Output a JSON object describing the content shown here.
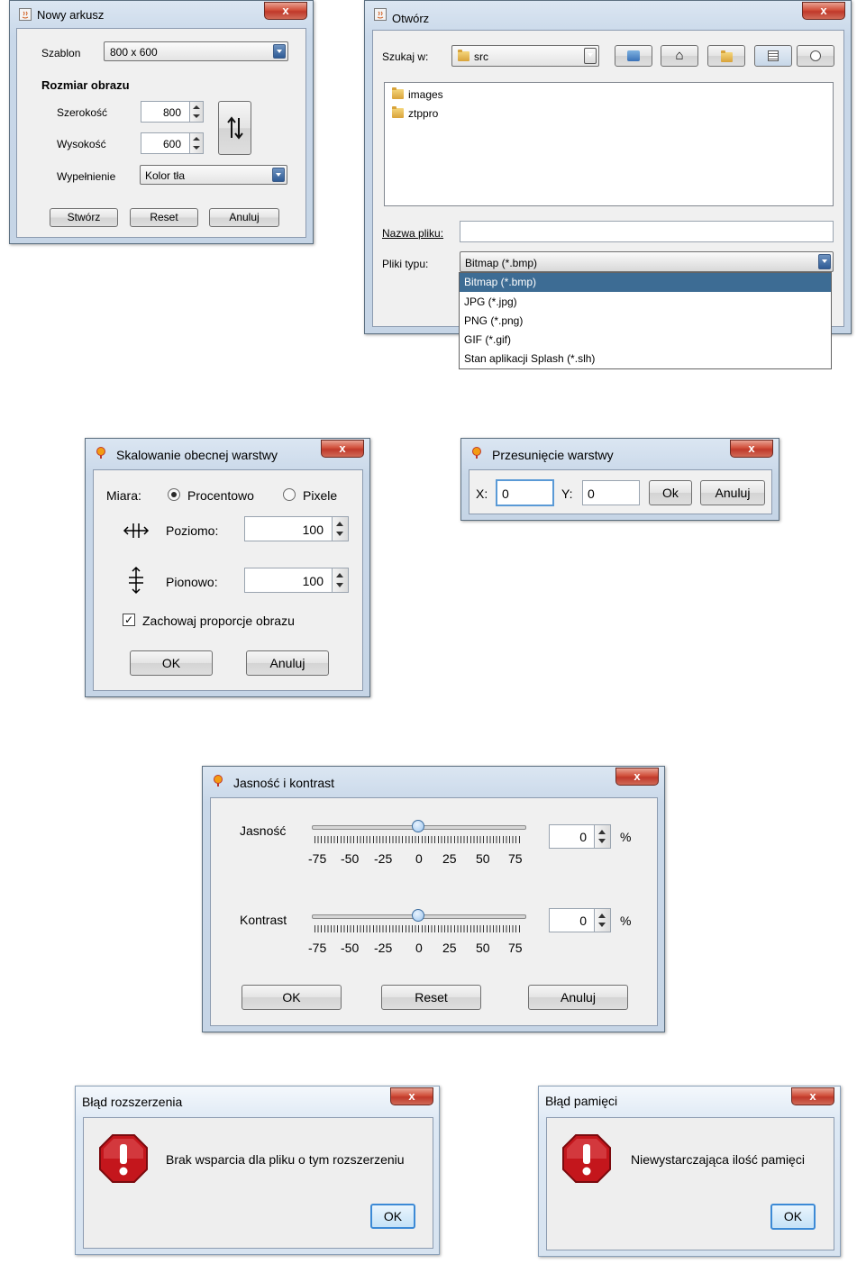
{
  "nowy_arkusz": {
    "title": "Nowy arkusz",
    "close": "x",
    "szablon_label": "Szablon",
    "szablon_value": "800 x 600",
    "section": "Rozmiar obrazu",
    "szerokosc_label": "Szerokość",
    "szerokosc_value": "800",
    "wysokosc_label": "Wysokość",
    "wysokosc_value": "600",
    "swap_icon": "swap-arrows",
    "wypelnienie_label": "Wypełnienie",
    "wypelnienie_value": "Kolor tła",
    "btn_create": "Stwórz",
    "btn_reset": "Reset",
    "btn_cancel": "Anuluj"
  },
  "otworz": {
    "title": "Otwórz",
    "close": "x",
    "lookin_label": "Szukaj w:",
    "lookin_value": "src",
    "files": [
      "images",
      "ztppro"
    ],
    "filename_label": "Nazwa pliku:",
    "filename_value": "",
    "filetype_label": "Pliki typu:",
    "filetype_value": "Bitmap (*.bmp)",
    "options": [
      "Bitmap (*.bmp)",
      "JPG (*.jpg)",
      "PNG (*.png)",
      "GIF (*.gif)",
      "Stan aplikacji Splash (*.slh)"
    ]
  },
  "skalowanie": {
    "title": "Skalowanie obecnej warstwy",
    "close": "x",
    "miara_label": "Miara:",
    "opt_percent": "Procentowo",
    "opt_pixel": "Pixele",
    "poziomo_label": "Poziomo:",
    "poziomo_value": "100",
    "pionowo_label": "Pionowo:",
    "pionowo_value": "100",
    "keep_ratio": "Zachowaj proporcje obrazu",
    "btn_ok": "OK",
    "btn_cancel": "Anuluj"
  },
  "przesuniecie": {
    "title": "Przesunięcie warstwy",
    "close": "x",
    "x_label": "X:",
    "x_value": "0",
    "y_label": "Y:",
    "y_value": "0",
    "btn_ok": "Ok",
    "btn_cancel": "Anuluj"
  },
  "jasnosc": {
    "title": "Jasność i kontrast",
    "close": "x",
    "jasnosc_label": "Jasność",
    "jasnosc_value": "0",
    "kontrast_label": "Kontrast",
    "kontrast_value": "0",
    "unit": "%",
    "slider_min": -75,
    "slider_max": 75,
    "tick_labels": [
      "-75",
      "-50",
      "-25",
      "0",
      "25",
      "50",
      "75"
    ],
    "btn_ok": "OK",
    "btn_reset": "Reset",
    "btn_cancel": "Anuluj"
  },
  "blad_rozszerzenia": {
    "title": "Błąd rozszerzenia",
    "close": "x",
    "message": "Brak wsparcia dla pliku o tym rozszerzeniu",
    "btn_ok": "OK"
  },
  "blad_pamieci": {
    "title": "Błąd pamięci",
    "close": "x",
    "message": "Niewystarczająca ilość pamięci",
    "btn_ok": "OK"
  },
  "colors": {
    "frame": "#c6d5e6",
    "close_red": "#c0392b",
    "selection": "#3d6c94",
    "error_red": "#c4161c"
  }
}
